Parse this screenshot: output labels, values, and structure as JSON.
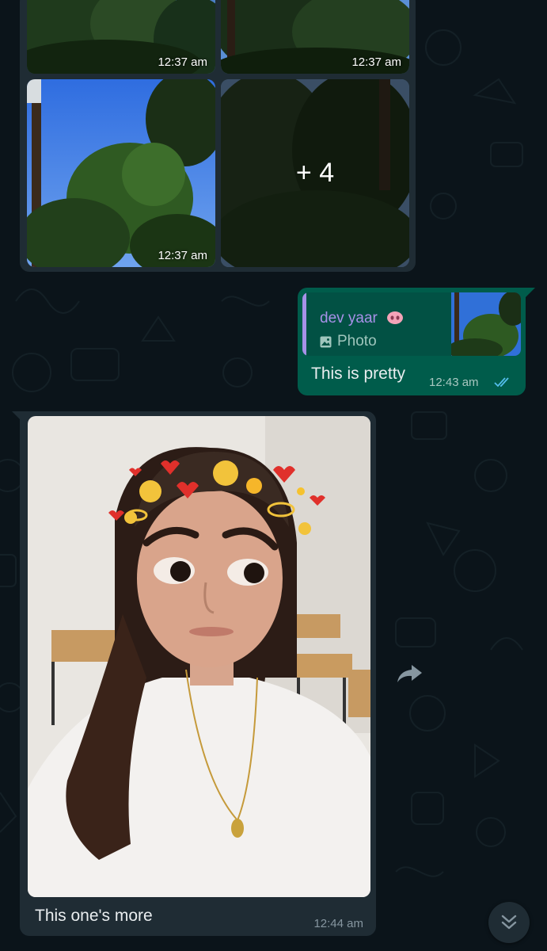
{
  "album": {
    "tiles": [
      {
        "time": "12:37 am"
      },
      {
        "time": "12:37 am"
      },
      {
        "time": "12:37 am"
      },
      {
        "more": "+ 4"
      }
    ]
  },
  "reply": {
    "quoted_author": "dev yaar",
    "quoted_emoji_icon": "pig-nose-icon",
    "quoted_type": "Photo",
    "text": "This is pretty",
    "time": "12:43 am",
    "status": "read"
  },
  "photo_message": {
    "caption": "This one's more",
    "time": "12:44 am"
  },
  "colors": {
    "background": "#0b141a",
    "incoming_bubble": "#1f2c34",
    "outgoing_bubble": "#005c4b",
    "quote_accent": "#a791e8",
    "read_ticks": "#53bdeb"
  }
}
